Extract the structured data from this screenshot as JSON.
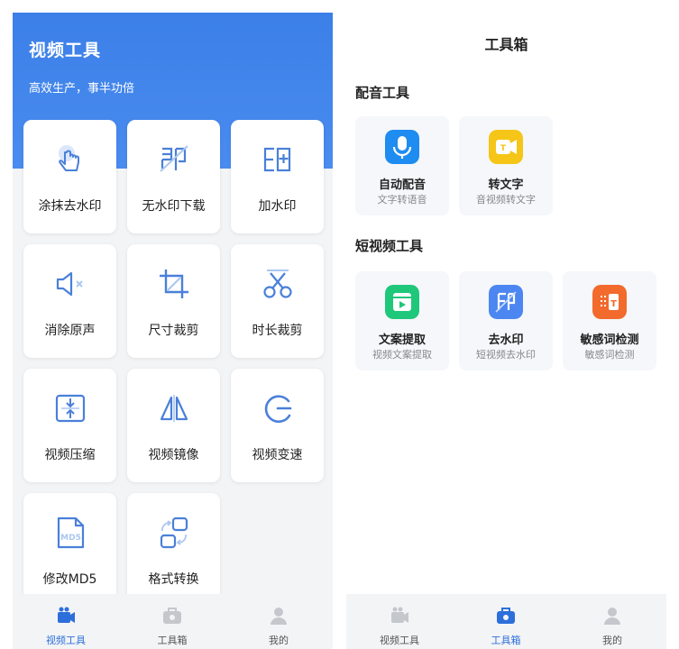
{
  "left_screen": {
    "header": {
      "title": "视频工具",
      "subtitle": "高效生产，事半功倍"
    },
    "tools": [
      {
        "label": "涂抹去水印",
        "icon": "hand-tap-icon"
      },
      {
        "label": "无水印下载",
        "icon": "no-watermark-icon"
      },
      {
        "label": "加水印",
        "icon": "add-watermark-icon"
      },
      {
        "label": "消除原声",
        "icon": "mute-icon"
      },
      {
        "label": "尺寸裁剪",
        "icon": "crop-icon"
      },
      {
        "label": "时长裁剪",
        "icon": "scissors-icon"
      },
      {
        "label": "视频压缩",
        "icon": "compress-icon"
      },
      {
        "label": "视频镜像",
        "icon": "mirror-icon"
      },
      {
        "label": "视频变速",
        "icon": "speed-icon"
      },
      {
        "label": "修改MD5",
        "icon": "md5-file-icon"
      },
      {
        "label": "格式转换",
        "icon": "convert-icon"
      }
    ],
    "tabbar": [
      {
        "label": "视频工具",
        "active": true
      },
      {
        "label": "工具箱",
        "active": false
      },
      {
        "label": "我的",
        "active": false
      }
    ]
  },
  "right_screen": {
    "title": "工具箱",
    "sections": [
      {
        "title": "配音工具",
        "items": [
          {
            "name": "自动配音",
            "desc": "文字转语音",
            "icon": "microphone-icon",
            "color": "#1e8cf0"
          },
          {
            "name": "转文字",
            "desc": "音视频转文字",
            "icon": "video-to-text-icon",
            "color": "#f5c518"
          }
        ]
      },
      {
        "title": "短视频工具",
        "items": [
          {
            "name": "文案提取",
            "desc": "视频文案提取",
            "icon": "copy-extract-icon",
            "color": "#1fc77a"
          },
          {
            "name": "去水印",
            "desc": "短视频去水印",
            "icon": "remove-watermark-icon",
            "color": "#4c86f0"
          },
          {
            "name": "敏感词检测",
            "desc": "敏感词检测",
            "icon": "sensitive-word-icon",
            "color": "#f26a2c"
          }
        ]
      }
    ],
    "tabbar": [
      {
        "label": "视频工具",
        "active": false
      },
      {
        "label": "工具箱",
        "active": true
      },
      {
        "label": "我的",
        "active": false
      }
    ]
  },
  "colors": {
    "accent": "#2c6fdb",
    "hero_blue": "#3b7fe8",
    "icon_blue": "#4a80d9",
    "inactive_icon": "#c4c7cc"
  }
}
